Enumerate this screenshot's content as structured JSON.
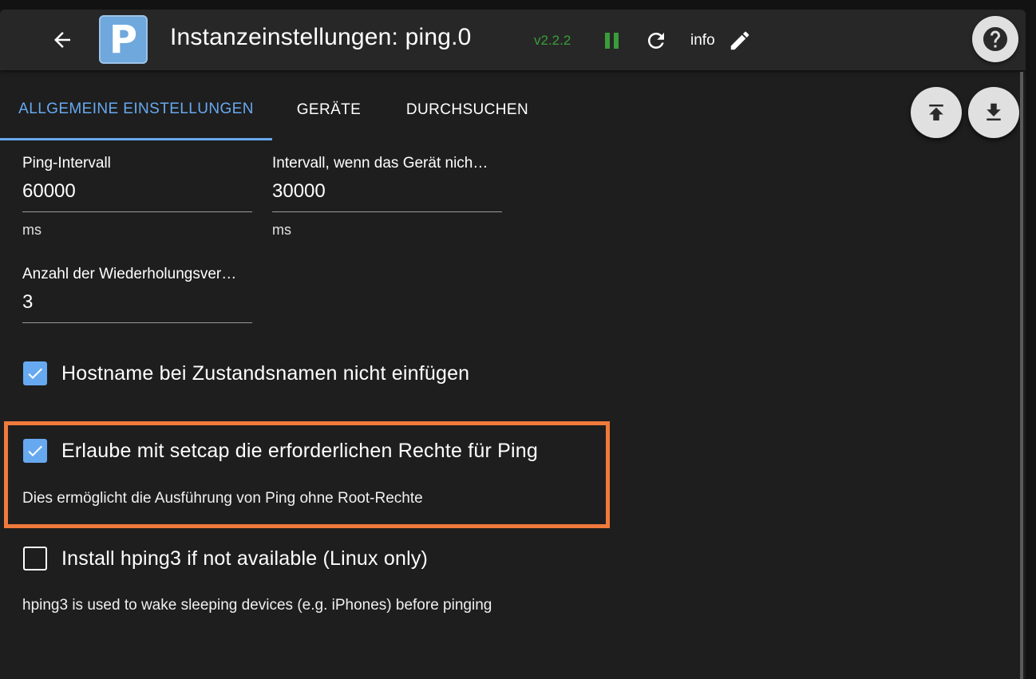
{
  "header": {
    "logo_letter": "P",
    "title": "Instanzeinstellungen: ping.0",
    "version": "v2.2.2",
    "info_label": "info",
    "icons": {
      "back": "arrow-left-icon",
      "pause": "pause-icon",
      "refresh": "refresh-icon",
      "edit": "pencil-icon",
      "help": "help-circle-icon"
    },
    "colors": {
      "version": "#3a9d3a",
      "pause": "#3a9d3a",
      "logo_bg": "#6fa8dc"
    }
  },
  "tabs": [
    {
      "label": "ALLGEMEINE EINSTELLUNGEN",
      "active": true
    },
    {
      "label": "GERÄTE",
      "active": false
    },
    {
      "label": "DURCHSUCHEN",
      "active": false
    }
  ],
  "actions": {
    "upload_icon": "upload-to-top-icon",
    "download_icon": "download-icon"
  },
  "fields": {
    "ping_interval": {
      "label": "Ping-Intervall",
      "value": "60000",
      "unit": "ms"
    },
    "interval_unreachable": {
      "label": "Intervall, wenn das Gerät nich…",
      "value": "30000",
      "unit": "ms"
    },
    "retries": {
      "label": "Anzahl der Wiederholungsver…",
      "value": "3"
    }
  },
  "checkboxes": {
    "no_hostname": {
      "label": "Hostname bei Zustandsnamen nicht einfügen",
      "checked": true
    },
    "setcap": {
      "label": "Erlaube mit setcap die erforderlichen Rechte für Ping",
      "checked": true,
      "help": "Dies ermöglicht die Ausführung von Ping ohne Root-Rechte"
    },
    "hping3": {
      "label": "Install hping3 if not available (Linux only)",
      "checked": false,
      "help": "hping3 is used to wake sleeping devices (e.g. iPhones) before pinging"
    }
  },
  "colors": {
    "accent": "#67a9f0",
    "highlight": "#f07a3c",
    "background": "#1e1e1e"
  }
}
